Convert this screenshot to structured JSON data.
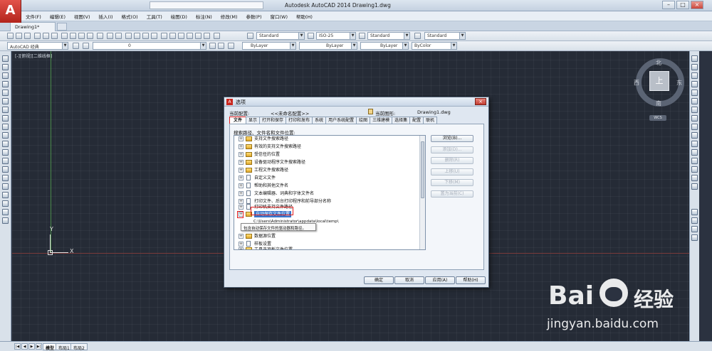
{
  "window": {
    "title": "Autodesk AutoCAD 2014    Drawing1.dwg",
    "logo": "A",
    "controls": [
      "–",
      "□",
      "×"
    ]
  },
  "menu": [
    "文件(F)",
    "编辑(E)",
    "视图(V)",
    "插入(I)",
    "格式(O)",
    "工具(T)",
    "绘图(D)",
    "标注(N)",
    "修改(M)",
    "参数(P)",
    "窗口(W)",
    "帮助(H)"
  ],
  "doc_tab": "Drawing1*",
  "toolbar": {
    "text_style": "Standard",
    "dim_style": "ISO-25",
    "table_style": "Standard",
    "mleader_style": "Standard",
    "workspace": "AutoCAD 经典",
    "layer": "0",
    "color": "ByLayer",
    "linetype": "ByLayer",
    "lineweight": "ByLayer",
    "plotstyle": "ByColor"
  },
  "canvas": {
    "viewport_label": "[-][俯视][二维线框]",
    "ucs_x": "X",
    "ucs_y": "Y"
  },
  "viewcube": {
    "face": "上",
    "north": "北",
    "south": "南",
    "east": "东",
    "west": "西",
    "wcs": "WCS"
  },
  "bottom": {
    "nav": [
      "|◀",
      "◀",
      "▶",
      "▶|"
    ],
    "tabs": [
      "模型",
      "布局1",
      "布局2"
    ]
  },
  "dialog": {
    "title": "选项",
    "title_icon": "A",
    "close": "×",
    "current_profile_label": "当前配置:",
    "current_profile_value": "<<未命名配置>>",
    "current_drawing_label": "当前图形:",
    "current_drawing_value": "Drawing1.dwg",
    "tabs": [
      "文件",
      "显示",
      "打开和保存",
      "打印和发布",
      "系统",
      "用户系统配置",
      "绘图",
      "三维建模",
      "选择集",
      "配置",
      "联机"
    ],
    "section_label": "搜索路径、文件名和文件位置:",
    "tree_items": [
      {
        "label": "支持文件搜索路径",
        "icon": "folder"
      },
      {
        "label": "有效的支持文件搜索路径",
        "icon": "folder"
      },
      {
        "label": "受信任的位置",
        "icon": "folder"
      },
      {
        "label": "设备驱动程序文件搜索路径",
        "icon": "folder"
      },
      {
        "label": "工程文件搜索路径",
        "icon": "folder"
      },
      {
        "label": "自定义文件",
        "icon": "doc"
      },
      {
        "label": "帮助和其他文件名",
        "icon": "doc"
      },
      {
        "label": "文本编辑器、词典和字体文件名",
        "icon": "doc"
      },
      {
        "label": "打印文件、后台打印程序和前导部分名称",
        "icon": "doc"
      },
      {
        "label": "打印机支持文件路径",
        "icon": "doc"
      },
      {
        "label": "自动保存文件位置",
        "icon": "folder",
        "selected": true
      },
      {
        "label": "数据源位置",
        "icon": "folder"
      },
      {
        "label": "样板设置",
        "icon": "doc"
      },
      {
        "label": "工具选项板文件位置",
        "icon": "folder"
      }
    ],
    "subpath": "C:\\Users\\Administrator\\appdata\\local\\temp\\",
    "tooltip": "包含自动保存文件的驱动器和路径。",
    "side_buttons": [
      {
        "label": "浏览(B)...",
        "enabled": true
      },
      {
        "label": "添加(D)...",
        "enabled": false
      },
      {
        "label": "删除(R)",
        "enabled": false
      },
      {
        "label": "上移(U)",
        "enabled": false
      },
      {
        "label": "下移(M)",
        "enabled": false
      },
      {
        "label": "置为当前(C)",
        "enabled": false
      }
    ],
    "footer": {
      "ok": "确定",
      "cancel": "取消",
      "apply": "应用(A)",
      "help": "帮助(H)"
    }
  },
  "watermark": {
    "logo": "Bai",
    "logo_tail": "经验",
    "url": "jingyan.baidu.com"
  }
}
